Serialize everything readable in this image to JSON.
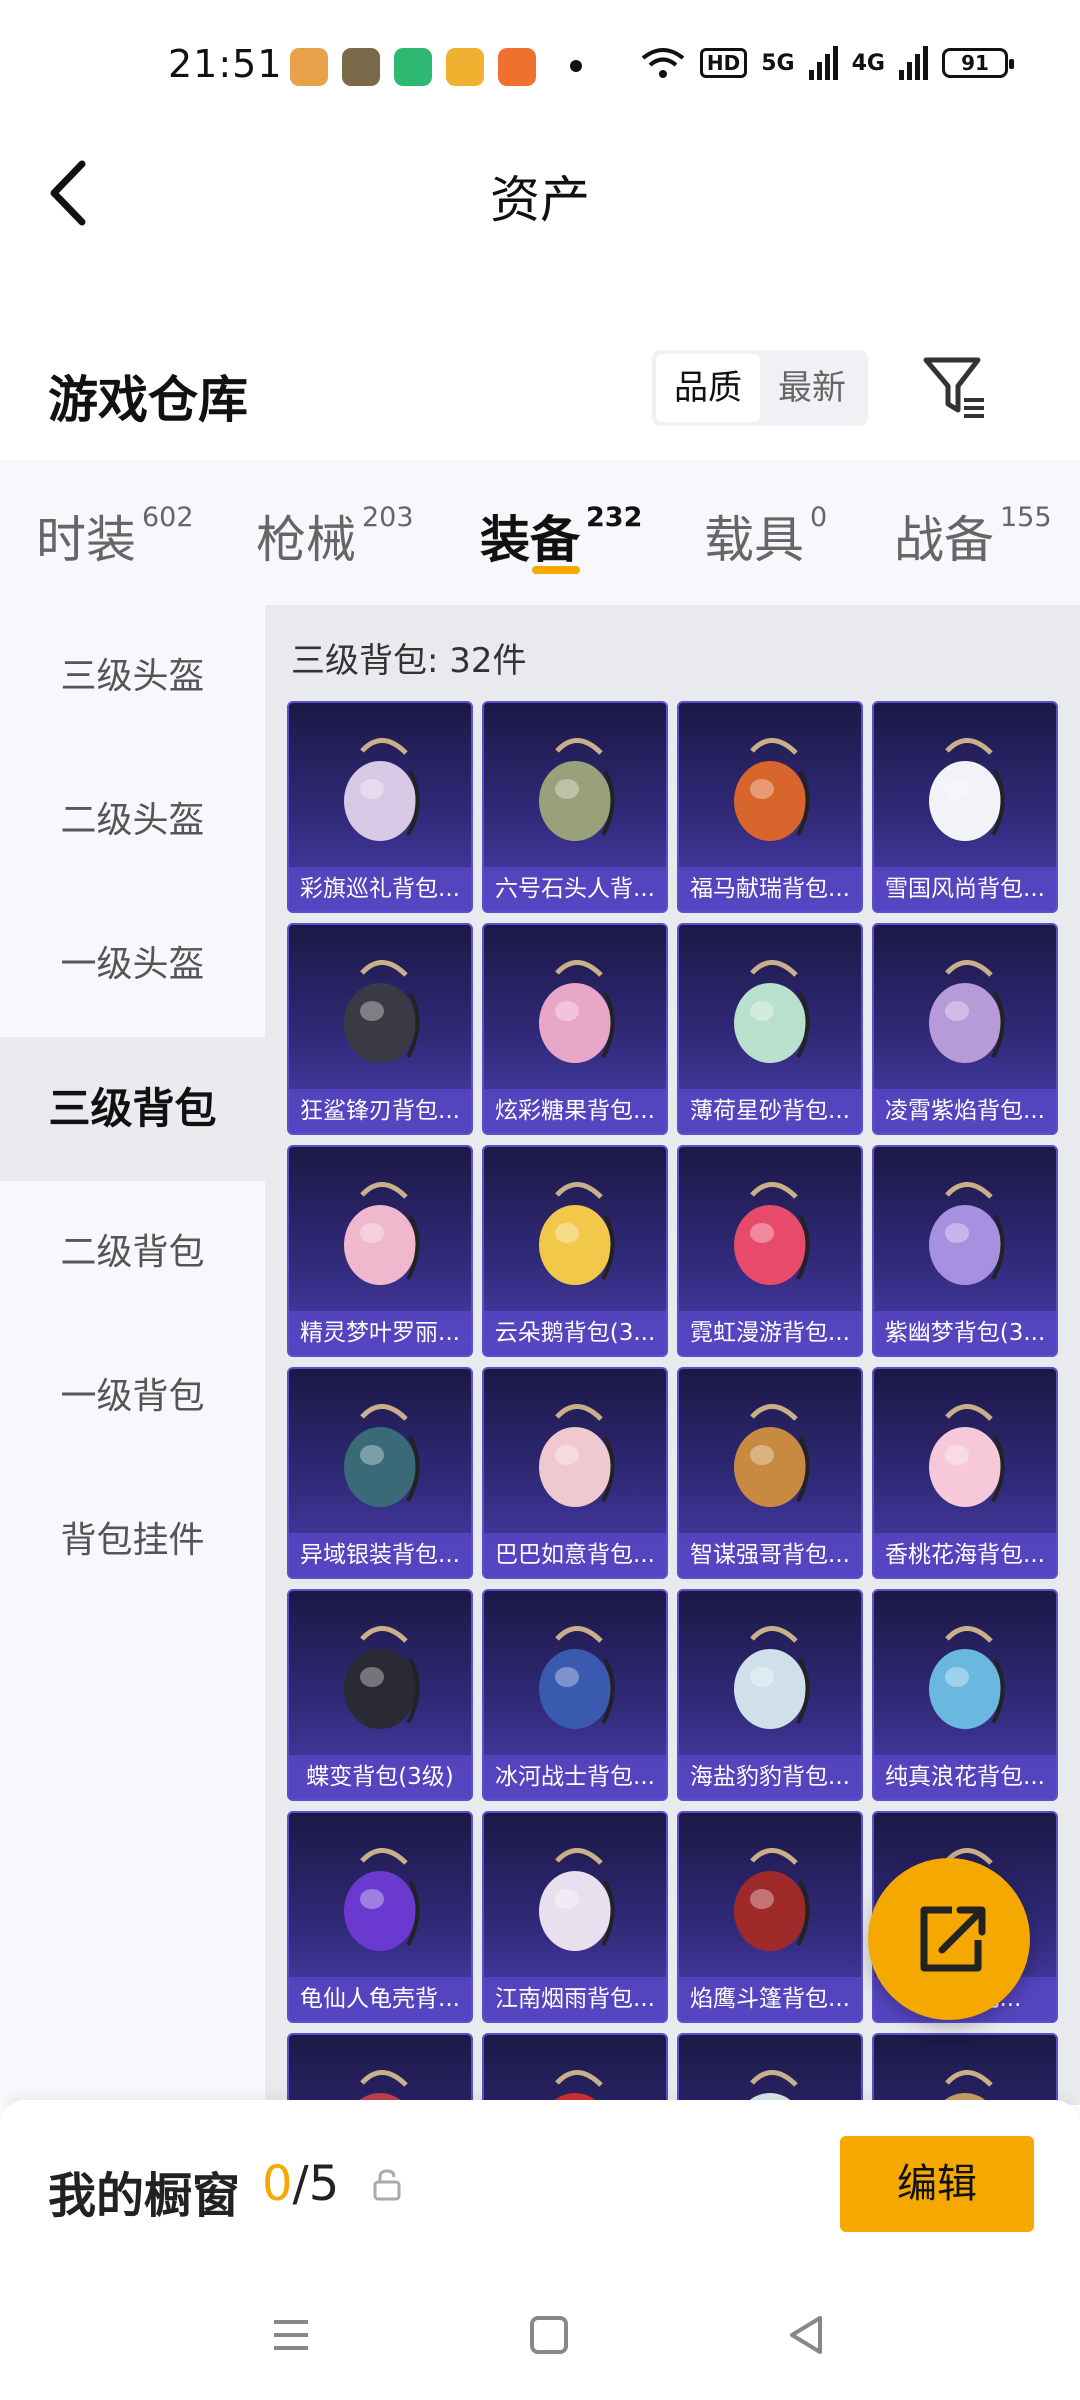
{
  "status_bar": {
    "time": "21:51",
    "network_label": "HD",
    "signal_5g": "5G",
    "signal_4g": "4G",
    "battery": "91"
  },
  "header": {
    "title": "资产"
  },
  "warehouse": {
    "title": "游戏仓库",
    "sort_options": [
      "品质",
      "最新"
    ],
    "selected_sort": "品质"
  },
  "categories": [
    {
      "label": "时装",
      "count": "602"
    },
    {
      "label": "枪械",
      "count": "203"
    },
    {
      "label": "装备",
      "count": "232",
      "active": true
    },
    {
      "label": "载具",
      "count": "0"
    },
    {
      "label": "战备",
      "count": "155"
    }
  ],
  "sidebar": {
    "items": [
      "三级头盔",
      "二级头盔",
      "一级头盔",
      "三级背包",
      "二级背包",
      "一级背包",
      "背包挂件"
    ],
    "active": "三级背包"
  },
  "content": {
    "count_label": "三级背包: 32件",
    "items": [
      "彩旗巡礼背包...",
      "六号石头人背...",
      "福马献瑞背包...",
      "雪国风尚背包...",
      "狂鲨锋刃背包...",
      "炫彩糖果背包...",
      "薄荷星砂背包...",
      "凌霄紫焰背包...",
      "精灵梦叶罗丽...",
      "云朵鹅背包(3...",
      "霓虹漫游背包...",
      "紫幽梦背包(3...",
      "异域银装背包...",
      "巴巴如意背包...",
      "智谋强哥背包...",
      "香桃花海背包...",
      "蝶变背包(3级)",
      "冰河战士背包...",
      "海盐豹豹背包...",
      "纯真浪花背包...",
      "龟仙人龟壳背...",
      "江南烟雨背包...",
      "焰鹰斗篷背包...",
      "宝...背包..."
    ]
  },
  "showcase": {
    "label": "我的橱窗",
    "current": "0",
    "total": "/5",
    "edit_button": "编辑"
  },
  "colors": {
    "accent": "#f5a800",
    "card_top": "#1c1845",
    "card_bottom": "#4d3fb0"
  }
}
